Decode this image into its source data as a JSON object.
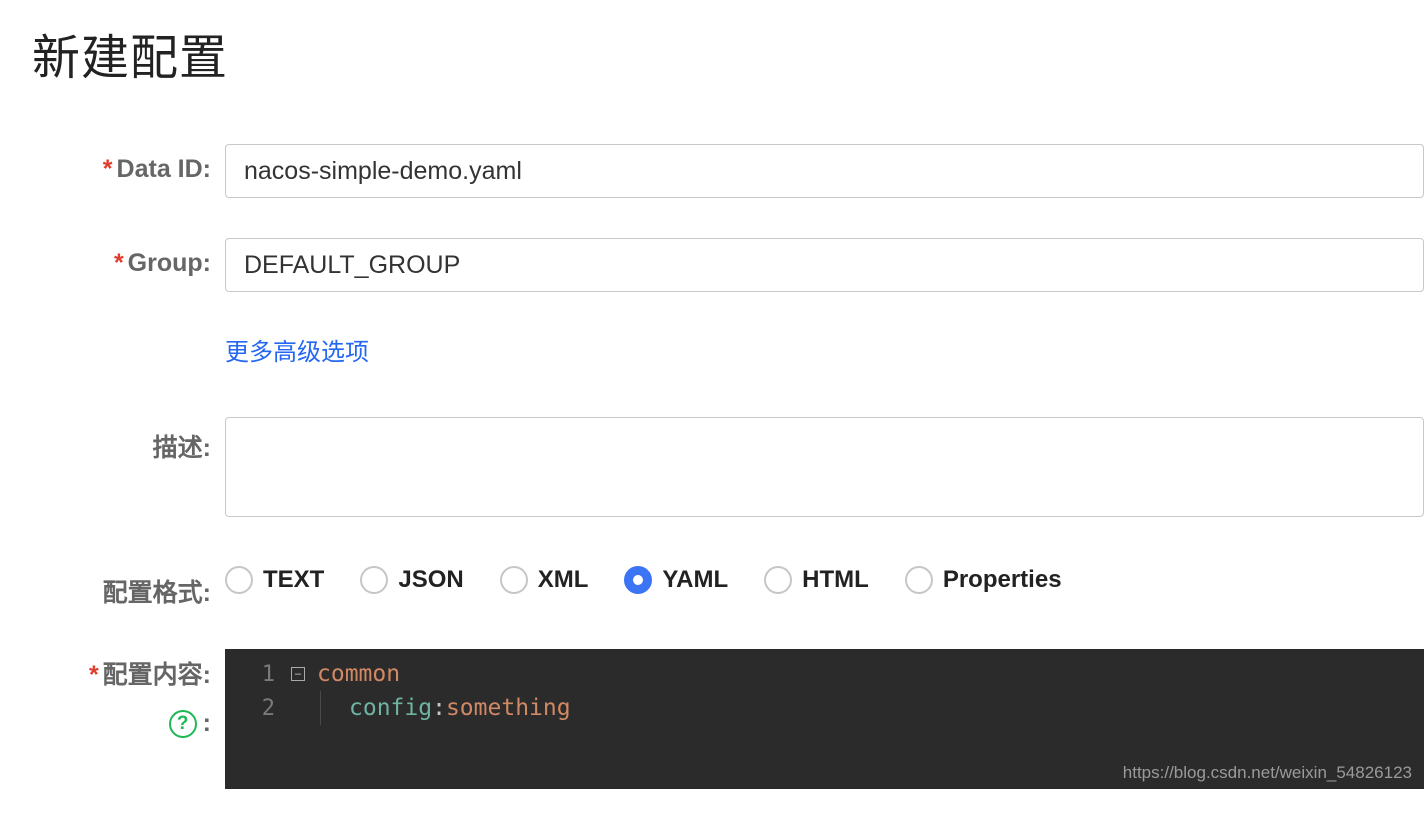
{
  "page": {
    "title": "新建配置"
  },
  "form": {
    "data_id": {
      "label": "Data ID:",
      "value": "nacos-simple-demo.yaml",
      "required": true
    },
    "group": {
      "label": "Group:",
      "value": "DEFAULT_GROUP",
      "required": true
    },
    "advanced_link": "更多高级选项",
    "description": {
      "label": "描述:",
      "value": ""
    },
    "format": {
      "label": "配置格式:",
      "options": [
        "TEXT",
        "JSON",
        "XML",
        "YAML",
        "HTML",
        "Properties"
      ],
      "selected": "YAML"
    },
    "content": {
      "label": "配置内容:",
      "required": true,
      "lines": [
        {
          "n": "1",
          "tokens": [
            {
              "t": "common",
              "c": "tok-key"
            }
          ],
          "foldable": true
        },
        {
          "n": "2",
          "tokens": [
            {
              "t": "config",
              "c": "tok-key2"
            },
            {
              "t": ": ",
              "c": "tok-colon"
            },
            {
              "t": "something",
              "c": "tok-txt"
            }
          ],
          "indented": true
        }
      ]
    }
  },
  "watermark": "https://blog.csdn.net/weixin_54826123"
}
